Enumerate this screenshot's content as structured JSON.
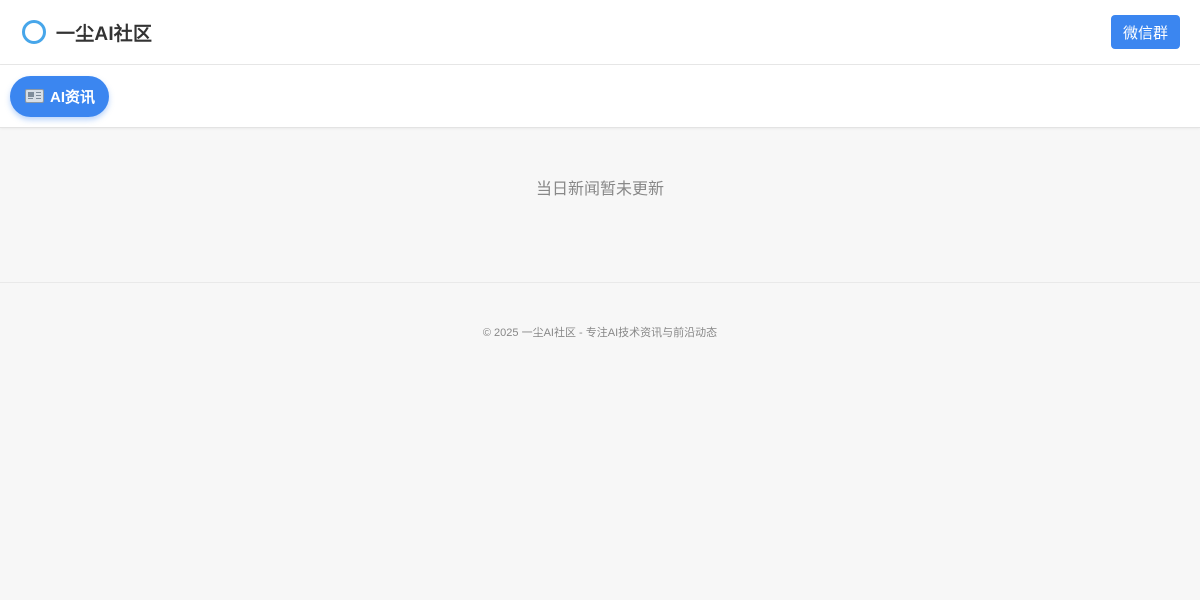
{
  "header": {
    "site_title": "一尘AI社区",
    "logo_icon": "ring-logo-icon",
    "wechat_button_label": "微信群"
  },
  "tabs": [
    {
      "icon": "newspaper-icon",
      "label": "AI资讯",
      "active": true
    }
  ],
  "main": {
    "empty_message": "当日新闻暂未更新"
  },
  "footer": {
    "copyright": "© 2025 一尘AI社区 - 专注AI技术资讯与前沿动态"
  },
  "colors": {
    "accent": "#3b86f0",
    "logo_ring": "#47a6ea",
    "page_background": "#f7f7f7",
    "muted_text": "#888888"
  }
}
